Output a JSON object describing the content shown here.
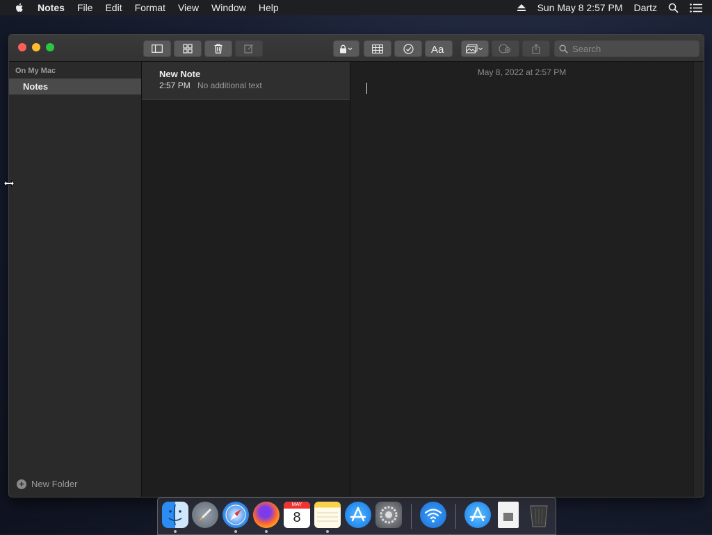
{
  "menubar": {
    "app_name": "Notes",
    "items": [
      "File",
      "Edit",
      "Format",
      "View",
      "Window",
      "Help"
    ],
    "clock": "Sun May 8  2:57 PM",
    "user": "Dartz"
  },
  "toolbar": {
    "search_placeholder": "Search"
  },
  "sidebar": {
    "section_title": "On My Mac",
    "folders": [
      {
        "label": "Notes",
        "selected": true
      }
    ],
    "new_folder_label": "New Folder"
  },
  "note_list": {
    "notes": [
      {
        "title": "New Note",
        "time": "2:57 PM",
        "preview": "No additional text"
      }
    ]
  },
  "editor": {
    "date": "May 8, 2022 at 2:57 PM"
  },
  "dock": {
    "apps": [
      "Finder",
      "Launchpad",
      "Safari",
      "Firefox",
      "Calendar",
      "Notes",
      "App Store",
      "System Preferences",
      "Wi-Fi",
      "App Store Folder",
      "File",
      "Trash"
    ],
    "calendar_month": "MAY",
    "calendar_day": "8"
  },
  "colors": {
    "window_bg": "#1f1f1f",
    "sidebar_bg": "#2a2a2a",
    "selection_bg": "#4a4a4a",
    "close": "#fe5f57",
    "minimize": "#febc2e",
    "maximize": "#28c840"
  }
}
